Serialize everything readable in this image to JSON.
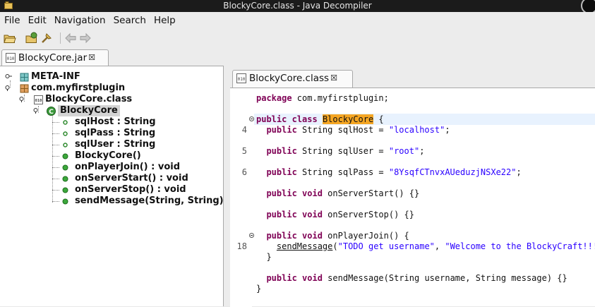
{
  "window": {
    "title": "BlockyCore.class - Java Decompiler"
  },
  "menu": [
    "File",
    "Edit",
    "Navigation",
    "Search",
    "Help"
  ],
  "toolbar": {
    "buttons": [
      "open-file-icon",
      "open-type-icon",
      "search-icon",
      "back-arrow-icon",
      "forward-arrow-icon"
    ]
  },
  "outer_tab": {
    "label": "BlockyCore.jar",
    "close": "☒"
  },
  "inner_tab": {
    "label": "BlockyCore.class",
    "close": "☒"
  },
  "tree": {
    "items": [
      {
        "label": "META-INF",
        "icon": "package-icon"
      },
      {
        "label": "com.myfirstplugin",
        "icon": "package-icon"
      },
      {
        "label": "BlockyCore.class",
        "icon": "class-file-icon"
      },
      {
        "label": "BlockyCore",
        "icon": "class-icon"
      },
      {
        "label": "sqlHost : String",
        "icon": "field-icon"
      },
      {
        "label": "sqlPass : String",
        "icon": "field-icon"
      },
      {
        "label": "sqlUser : String",
        "icon": "field-icon"
      },
      {
        "label": "BlockyCore()",
        "icon": "method-icon"
      },
      {
        "label": "onPlayerJoin() : void",
        "icon": "method-icon"
      },
      {
        "label": "onServerStart() : void",
        "icon": "method-icon"
      },
      {
        "label": "onServerStop() : void",
        "icon": "method-icon"
      },
      {
        "label": "sendMessage(String, String)",
        "icon": "method-icon"
      }
    ]
  },
  "code": {
    "l1": {
      "kw": "package",
      "rest": " com.myfirstplugin;"
    },
    "l2": {
      "kw1": "public",
      "kw2": "class",
      "name": "BlockyCore",
      "rest": " {"
    },
    "l3": {
      "ln": "4",
      "kw": "public",
      "mid": " String sqlHost = ",
      "str": "\"localhost\"",
      "end": ";"
    },
    "l4": {
      "ln": "5",
      "kw": "public",
      "mid": " String sqlUser = ",
      "str": "\"root\"",
      "end": ";"
    },
    "l5": {
      "ln": "6",
      "kw": "public",
      "mid": " String sqlPass = ",
      "str": "\"8YsqfCTnvxAUeduzjNSXe22\"",
      "end": ";"
    },
    "l6": {
      "kw1": "public",
      "kw2": "void",
      "rest": " onServerStart() {}"
    },
    "l7": {
      "kw1": "public",
      "kw2": "void",
      "rest": " onServerStop() {}"
    },
    "l8": {
      "kw1": "public",
      "kw2": "void",
      "rest": " onPlayerJoin() {"
    },
    "l9": {
      "ln": "18",
      "call": "sendMessage",
      "open": "(",
      "s1": "\"TODO get username\"",
      "sep": ", ",
      "s2": "\"Welcome to the BlockyCraft!!!!!!"
    },
    "l10": {
      "text": "}"
    },
    "l11": {
      "kw1": "public",
      "kw2": "void",
      "rest": " sendMessage(String username, String message) {}"
    },
    "l12": {
      "text": "}"
    }
  }
}
